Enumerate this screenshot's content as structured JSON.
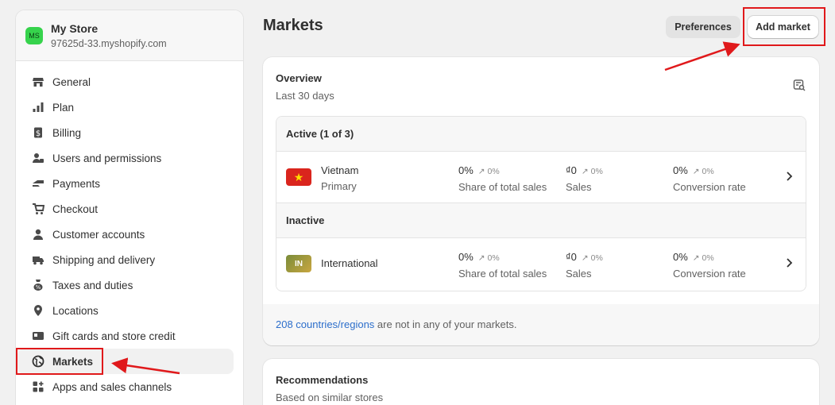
{
  "store": {
    "initials": "MS",
    "name": "My Store",
    "url": "97625d-33.myshopify.com"
  },
  "nav": [
    {
      "label": "General",
      "icon": "store-icon"
    },
    {
      "label": "Plan",
      "icon": "plan-icon"
    },
    {
      "label": "Billing",
      "icon": "billing-icon"
    },
    {
      "label": "Users and permissions",
      "icon": "users-icon"
    },
    {
      "label": "Payments",
      "icon": "payments-icon"
    },
    {
      "label": "Checkout",
      "icon": "cart-icon"
    },
    {
      "label": "Customer accounts",
      "icon": "person-icon"
    },
    {
      "label": "Shipping and delivery",
      "icon": "truck-icon"
    },
    {
      "label": "Taxes and duties",
      "icon": "tax-icon"
    },
    {
      "label": "Locations",
      "icon": "location-pin-icon"
    },
    {
      "label": "Gift cards and store credit",
      "icon": "gift-card-icon"
    },
    {
      "label": "Markets",
      "icon": "globe-icon",
      "active": true
    },
    {
      "label": "Apps and sales channels",
      "icon": "apps-icon"
    }
  ],
  "header": {
    "title": "Markets",
    "preferences": "Preferences",
    "add_market": "Add market"
  },
  "overview": {
    "title": "Overview",
    "subtitle": "Last 30 days",
    "active_label": "Active (1 of 3)",
    "inactive_label": "Inactive",
    "markets": [
      {
        "name": "Vietnam",
        "sub": "Primary",
        "flag": "VN",
        "share": "0%",
        "share_trend": "0%",
        "share_label": "Share of total sales",
        "sales": "₫0",
        "sales_trend": "0%",
        "sales_label": "Sales",
        "conv": "0%",
        "conv_trend": "0%",
        "conv_label": "Conversion rate"
      },
      {
        "name": "International",
        "sub": "",
        "flag": "IN",
        "share": "0%",
        "share_trend": "0%",
        "share_label": "Share of total sales",
        "sales": "₫0",
        "sales_trend": "0%",
        "sales_label": "Sales",
        "conv": "0%",
        "conv_trend": "0%",
        "conv_label": "Conversion rate"
      }
    ],
    "footer_link": "208 countries/regions",
    "footer_text": " are not in any of your markets."
  },
  "recommendations": {
    "title": "Recommendations",
    "subtitle": "Based on similar stores"
  },
  "colors": {
    "accent_link": "#2c6ecb",
    "annotation": "#e0191b",
    "avatar": "#36d34c"
  }
}
